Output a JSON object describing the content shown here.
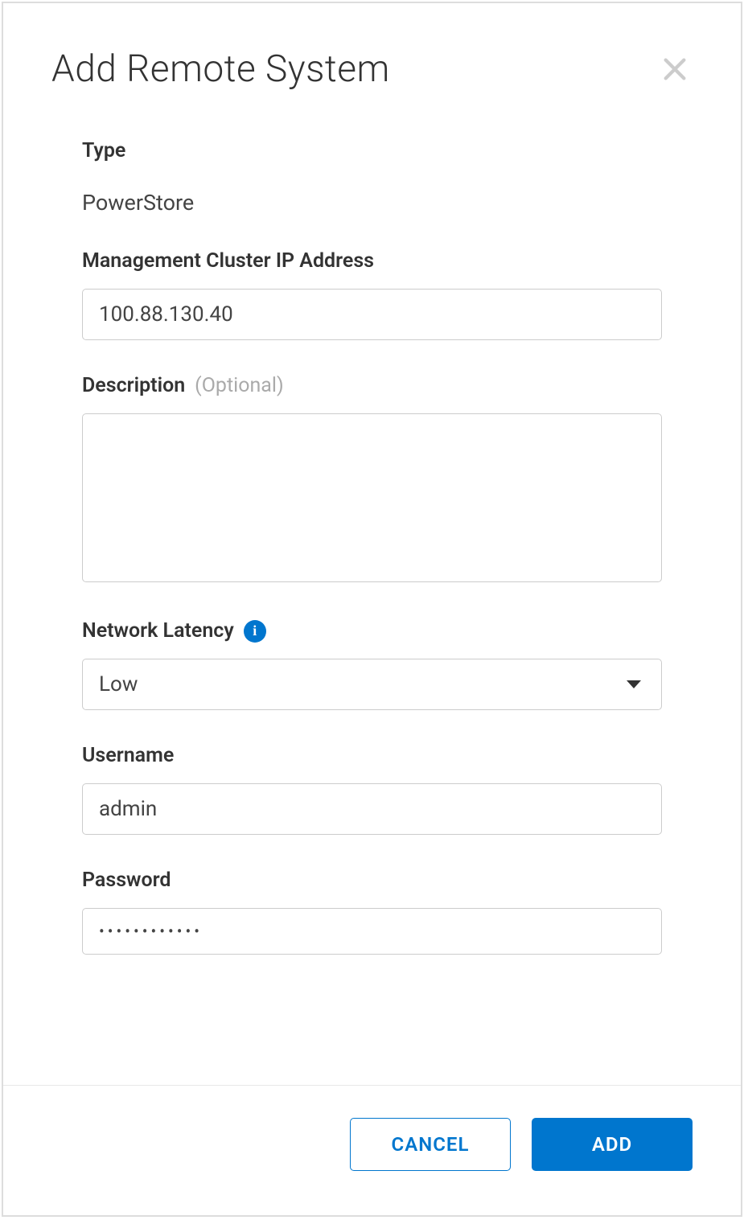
{
  "header": {
    "title": "Add Remote System"
  },
  "form": {
    "type": {
      "label": "Type",
      "value": "PowerStore"
    },
    "management_ip": {
      "label": "Management Cluster IP Address",
      "value": "100.88.130.40"
    },
    "description": {
      "label": "Description",
      "optional_hint": "(Optional)",
      "value": ""
    },
    "network_latency": {
      "label": "Network Latency",
      "selected": "Low"
    },
    "username": {
      "label": "Username",
      "value": "admin"
    },
    "password": {
      "label": "Password",
      "value": "••••••••••••"
    }
  },
  "footer": {
    "cancel_label": "CANCEL",
    "add_label": "ADD"
  }
}
